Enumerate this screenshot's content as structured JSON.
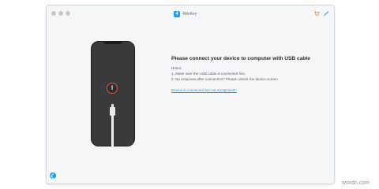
{
  "app": {
    "title": "4MeKey"
  },
  "titlebar": {
    "cart_icon": "cart-icon",
    "tool_icon": "wand-icon"
  },
  "main": {
    "headline": "Please connect your device to computer with USB cable",
    "notes_title": "Notes:",
    "notes": [
      "1. Make sure the USB cable is connected fine.",
      "2. No response after connection? Please unlock the device screen."
    ],
    "link": "Device is connected but not recognized?"
  },
  "footer": {
    "home_icon": "back-home-icon"
  },
  "watermark": "wsxdn.com",
  "colors": {
    "accent": "#1e9bef",
    "alert": "#e0533d",
    "phone": "#3a3a3c"
  }
}
